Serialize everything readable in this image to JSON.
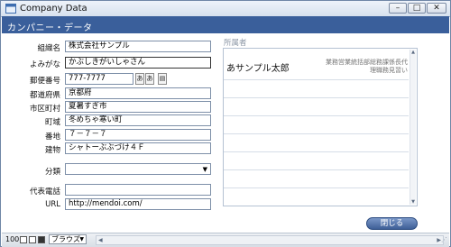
{
  "window": {
    "title": "Company Data",
    "icon": "app-window-icon",
    "controls": {
      "minimize": "–",
      "maximize": "□",
      "close": "✕"
    }
  },
  "header": {
    "title": "カンパニー・データ"
  },
  "form": {
    "fields": [
      {
        "label": "組織名",
        "value": "株式会社サンプル"
      },
      {
        "label": "よみがな",
        "value": "かぶしきがいしゃさん"
      },
      {
        "label": "郵便番号",
        "value": "777-7777"
      },
      {
        "label": "都道府県",
        "value": "京都府"
      },
      {
        "label": "市区町村",
        "value": "夏暑すぎ市"
      },
      {
        "label": "町域",
        "value": "冬めちゃ寒い町"
      },
      {
        "label": "番地",
        "value": "７－７－７"
      },
      {
        "label": "建物",
        "value": "シャトーぶぶづけ４Ｆ"
      },
      {
        "label": "分類",
        "value": ""
      },
      {
        "label": "代表電話",
        "value": ""
      },
      {
        "label": "URL",
        "value": "http://mendoi.com/"
      }
    ],
    "ime_buttons": [
      "あ",
      "あ",
      "▤"
    ]
  },
  "members": {
    "label": "所属者",
    "rows": [
      {
        "name": "あサンプル太郎",
        "info": "業務営業統括部総務課係長代理職務見習い"
      }
    ]
  },
  "buttons": {
    "close": "閉じる"
  },
  "status": {
    "zoom": "100",
    "mode": "ブラウズ"
  }
}
